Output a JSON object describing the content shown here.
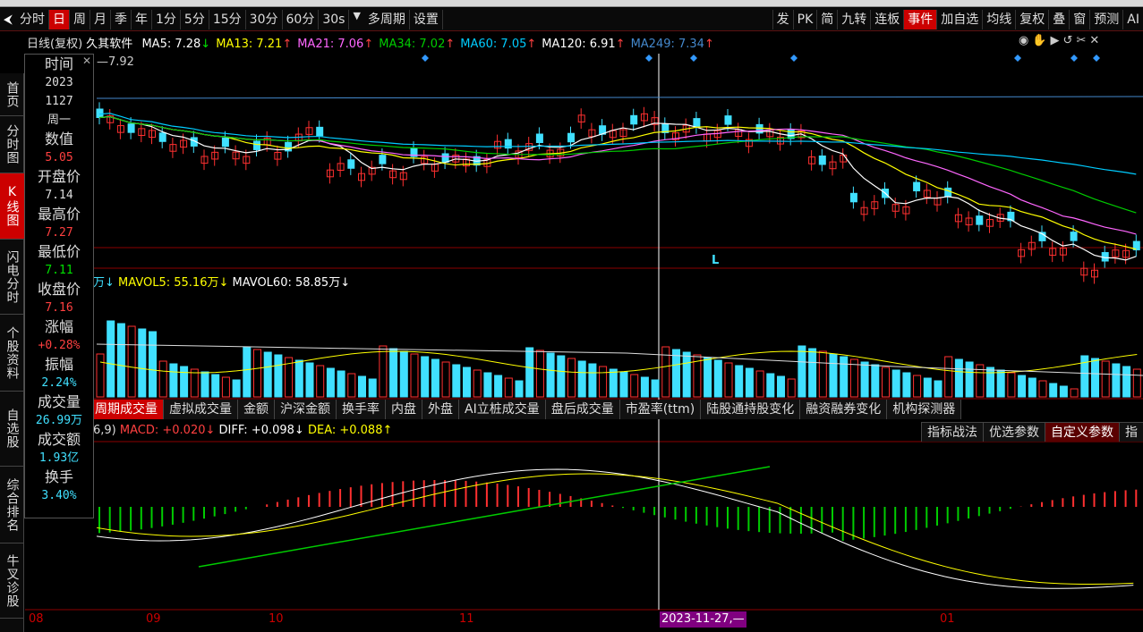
{
  "toolbar": {
    "periods": [
      "分时",
      "日",
      "周",
      "月",
      "季",
      "年",
      "1分",
      "5分",
      "15分",
      "30分",
      "60分",
      "30s",
      "多周期",
      "设置"
    ],
    "active_period": "日",
    "right_buttons": [
      "发",
      "PK",
      "简",
      "九转",
      "连板",
      "事件",
      "加自选",
      "均线",
      "复权",
      "叠",
      "窗",
      "预测",
      "AI"
    ]
  },
  "sidenav": [
    "首页",
    "分时图",
    "K线图",
    "闪电分时",
    "个股资料",
    "自选股",
    "综合排名",
    "牛叉诊股"
  ],
  "active_nav": "K线图",
  "kline_header": {
    "title": "日线(复权)",
    "name": "久其软件",
    "ma": [
      {
        "label": "MA5: 7.28",
        "arrow": "↓",
        "color": "#ffffff"
      },
      {
        "label": "MA13: 7.21",
        "arrow": "↑",
        "color": "#ffff00"
      },
      {
        "label": "MA21: 7.06",
        "arrow": "↑",
        "color": "#ff66ff"
      },
      {
        "label": "MA34: 7.02",
        "arrow": "↑",
        "color": "#00cc00"
      },
      {
        "label": "MA60: 7.05",
        "arrow": "↑",
        "color": "#00ccff"
      },
      {
        "label": "MA120: 6.91",
        "arrow": "↑",
        "color": "#ffffff"
      },
      {
        "label": "MA249: 7.34",
        "arrow": "↑",
        "color": "#4488cc"
      }
    ],
    "top_price": "7.92",
    "icons": [
      "eye-icon",
      "hand-icon",
      "play-icon",
      "undo-icon",
      "scissors-icon",
      "close-icon"
    ]
  },
  "infopanel": [
    {
      "label": "时间",
      "values": [
        "2023",
        "1127",
        "周一"
      ],
      "color": "w"
    },
    {
      "label": "数值",
      "values": [
        "5.05"
      ],
      "color": "r"
    },
    {
      "label": "开盘价",
      "values": [
        "7.14"
      ],
      "color": "w"
    },
    {
      "label": "最高价",
      "values": [
        "7.27"
      ],
      "color": "r"
    },
    {
      "label": "最低价",
      "values": [
        "7.11"
      ],
      "color": "g"
    },
    {
      "label": "收盘价",
      "values": [
        "7.16"
      ],
      "color": "r"
    },
    {
      "label": "涨幅",
      "values": [
        "+0.28%"
      ],
      "color": "r"
    },
    {
      "label": "振幅",
      "values": [
        "2.24%"
      ],
      "color": "c"
    },
    {
      "label": "成交量",
      "values": [
        "26.99万"
      ],
      "color": "c"
    },
    {
      "label": "成交额",
      "values": [
        "1.93亿"
      ],
      "color": "c"
    },
    {
      "label": "换手",
      "values": [
        "3.40%"
      ],
      "color": "c"
    }
  ],
  "volume_header": {
    "prefix": "万↓",
    "mavol5": "MAVOL5: 55.16万↓",
    "mavol60": "MAVOL60: 58.85万↓"
  },
  "subtabs": [
    "周期成交量",
    "虚拟成交量",
    "金额",
    "沪深金额",
    "换手率",
    "内盘",
    "外盘",
    "AI立桩成交量",
    "盘后成交量",
    "市盈率(ttm)",
    "陆股通持股变化",
    "融资融券变化",
    "机构探测器"
  ],
  "active_subtab": "周期成交量",
  "macd_header": {
    "prefix": "6,9)",
    "macd": "MACD: +0.020↓",
    "diff": "DIFF: +0.098↓",
    "dea": "DEA: +0.088↑"
  },
  "right_tabs": [
    "指标战法",
    "优选参数",
    "自定义参数",
    "指"
  ],
  "active_right_tab": "自定义参数",
  "xaxis": {
    "labels": [
      "08",
      "09",
      "10",
      "11",
      "01"
    ],
    "cursor_date": "2023-11-27,—",
    "marker": "L"
  }
}
